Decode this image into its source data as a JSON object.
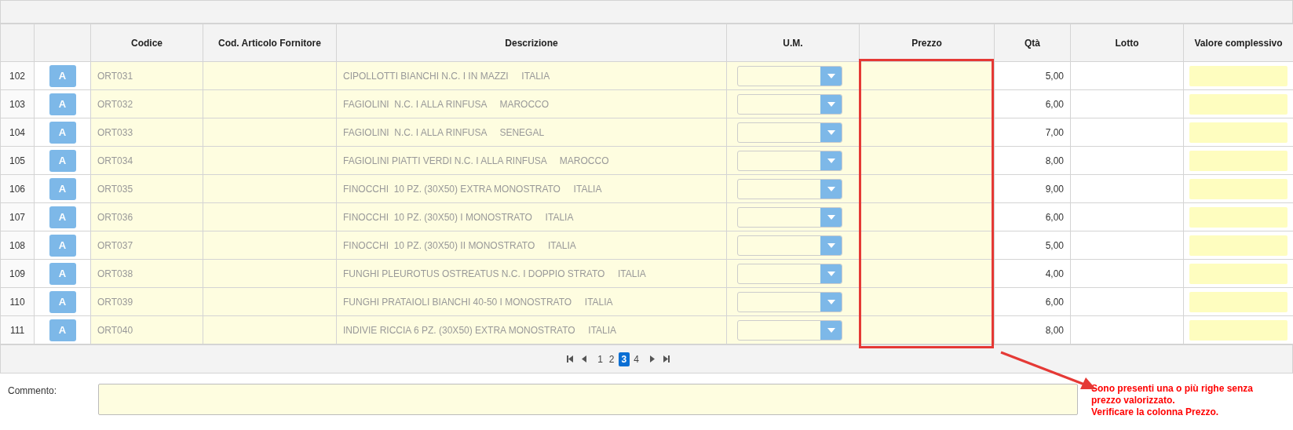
{
  "table": {
    "columns": [
      "Codice",
      "Cod. Articolo Fornitore",
      "Descrizione",
      "U.M.",
      "Prezzo",
      "Qtà",
      "Lotto",
      "Valore complessivo"
    ],
    "rows": [
      {
        "number": "102",
        "action": "A",
        "code": "ORT031",
        "description": "CIPOLLOTTI BIANCHI N.C. I IN MAZZI     ITALIA",
        "quantity": "5,00"
      },
      {
        "number": "103",
        "action": "A",
        "code": "ORT032",
        "description": "FAGIOLINI  N.C. I ALLA RINFUSA     MAROCCO",
        "quantity": "6,00"
      },
      {
        "number": "104",
        "action": "A",
        "code": "ORT033",
        "description": "FAGIOLINI  N.C. I ALLA RINFUSA     SENEGAL",
        "quantity": "7,00"
      },
      {
        "number": "105",
        "action": "A",
        "code": "ORT034",
        "description": "FAGIOLINI PIATTI VERDI N.C. I ALLA RINFUSA     MAROCCO",
        "quantity": "8,00"
      },
      {
        "number": "106",
        "action": "A",
        "code": "ORT035",
        "description": "FINOCCHI  10 PZ. (30X50) EXTRA MONOSTRATO     ITALIA",
        "quantity": "9,00"
      },
      {
        "number": "107",
        "action": "A",
        "code": "ORT036",
        "description": "FINOCCHI  10 PZ. (30X50) I MONOSTRATO     ITALIA",
        "quantity": "6,00"
      },
      {
        "number": "108",
        "action": "A",
        "code": "ORT037",
        "description": "FINOCCHI  10 PZ. (30X50) II MONOSTRATO     ITALIA",
        "quantity": "5,00"
      },
      {
        "number": "109",
        "action": "A",
        "code": "ORT038",
        "description": "FUNGHI PLEUROTUS OSTREATUS N.C. I DOPPIO STRATO     ITALIA",
        "quantity": "4,00"
      },
      {
        "number": "110",
        "action": "A",
        "code": "ORT039",
        "description": "FUNGHI PRATAIOLI BIANCHI 40-50 I MONOSTRATO     ITALIA",
        "quantity": "6,00"
      },
      {
        "number": "111",
        "action": "A",
        "code": "ORT040",
        "description": "INDIVIE RICCIA 6 PZ. (30X50) EXTRA MONOSTRATO     ITALIA",
        "quantity": "8,00"
      }
    ]
  },
  "pager": {
    "pages": [
      {
        "label": "1",
        "selected": false
      },
      {
        "label": "2",
        "selected": false
      },
      {
        "label": "3",
        "selected": true
      },
      {
        "label": "4",
        "selected": false
      }
    ]
  },
  "comment": {
    "label": "Commento:"
  },
  "annotation": {
    "message": [
      "Sono presenti una o più righe senza prezzo valorizzato.",
      "Verificare la colonna Prezzo."
    ]
  }
}
